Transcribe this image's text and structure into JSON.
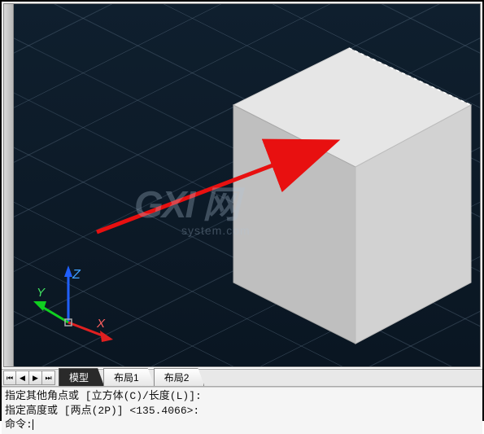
{
  "tabs": {
    "nav_first": "⏮",
    "nav_prev": "◀",
    "nav_next": "▶",
    "nav_last": "⏭",
    "model": "模型",
    "layout1": "布局1",
    "layout2": "布局2"
  },
  "ucs": {
    "x_label": "X",
    "y_label": "Y",
    "z_label": "Z"
  },
  "watermark": {
    "big": "GXI 网",
    "small": "system.com"
  },
  "command": {
    "line1": "指定其他角点或 [立方体(C)/长度(L)]:",
    "line2": "指定高度或 [两点(2P)] <135.4066>:",
    "prompt": "命令:"
  }
}
